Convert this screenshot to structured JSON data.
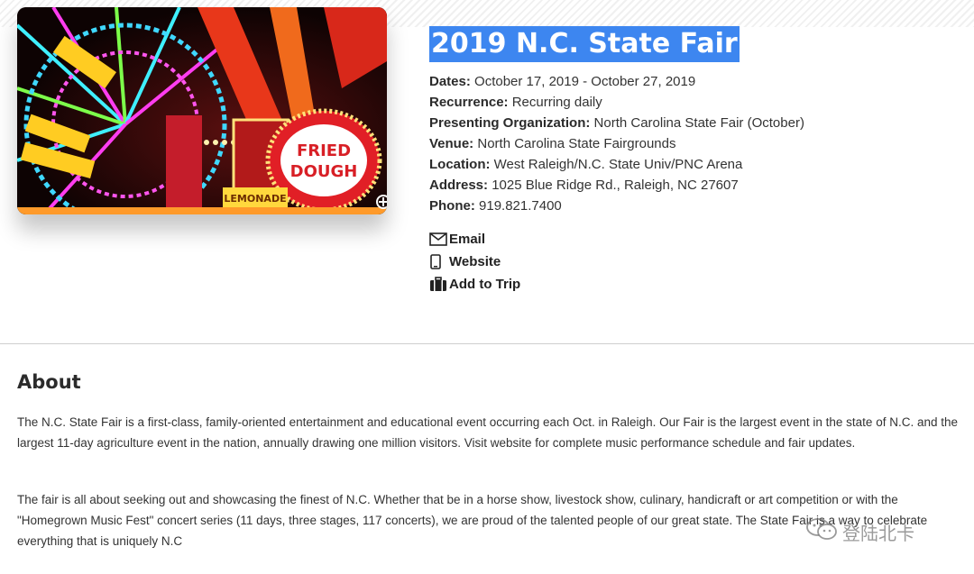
{
  "event": {
    "title": "2019 N.C. State Fair",
    "image_alt": "State fair ferris wheel and Fried Dough stand at night",
    "image_sign_text": "FRIED DOUGH",
    "image_sign_sub": "LEMONADE"
  },
  "details": [
    {
      "label": "Dates:",
      "value": "October 17, 2019 - October 27, 2019"
    },
    {
      "label": "Recurrence:",
      "value": "Recurring daily"
    },
    {
      "label": "Presenting Organization:",
      "value": "North Carolina State Fair (October)"
    },
    {
      "label": "Venue:",
      "value": "North Carolina State Fairgrounds"
    },
    {
      "label": "Location:",
      "value": "West Raleigh/N.C. State Univ/PNC Arena"
    },
    {
      "label": "Address:",
      "value": "1025 Blue Ridge Rd., Raleigh, NC 27607"
    },
    {
      "label": "Phone:",
      "value": "919.821.7400"
    }
  ],
  "actions": [
    {
      "label": "Email",
      "icon": "envelope-icon"
    },
    {
      "label": "Website",
      "icon": "mobile-icon"
    },
    {
      "label": "Add to Trip",
      "icon": "suitcase-icon"
    }
  ],
  "about": {
    "heading": "About",
    "paragraphs": [
      "The N.C. State Fair is a first-class, family-oriented entertainment and educational event occurring each Oct. in Raleigh. Our Fair is the largest event in the state of N.C. and the largest 11-day agriculture event in the nation, annually drawing one million visitors. Visit website for complete music performance schedule and fair updates.",
      "The fair is all about seeking out and showcasing the finest of N.C. Whether that be in a horse show, livestock show, culinary, handicraft or art competition or with the \"Homegrown Music Fest\" concert series (11 days, three stages, 117 concerts), we are proud of the talented people of our great state. The State Fair is a way to celebrate everything that is uniquely N.C"
    ]
  },
  "watermark": {
    "text": "登陆北卡",
    "icon": "wechat-icon"
  }
}
